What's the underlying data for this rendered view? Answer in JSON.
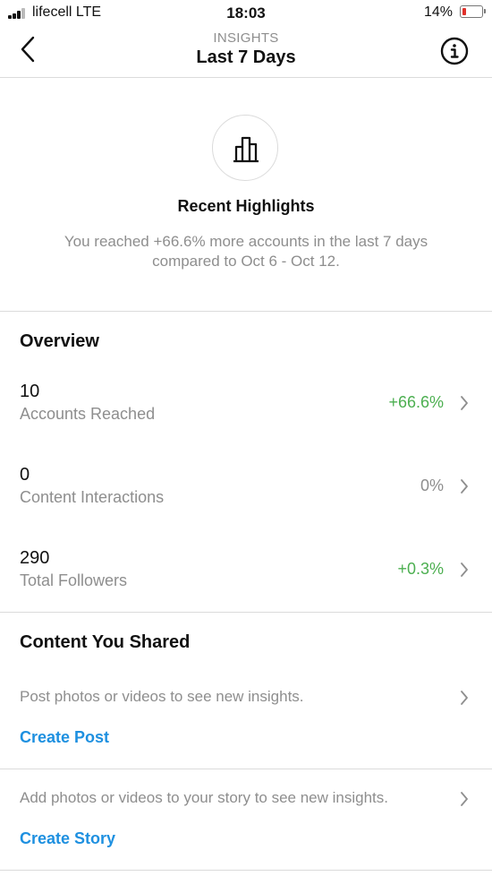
{
  "status_bar": {
    "carrier": "lifecell  LTE",
    "time": "18:03",
    "battery_percent": "14%",
    "battery_level": 0.14,
    "battery_color": "#e0302a"
  },
  "nav": {
    "subtitle": "INSIGHTS",
    "title": "Last 7 Days",
    "back_icon": "chevron-left-icon",
    "info_icon": "info-icon"
  },
  "highlights": {
    "icon": "bar-chart-icon",
    "title": "Recent Highlights",
    "description": "You reached +66.6% more accounts in the last 7 days compared to Oct 6 - Oct 12."
  },
  "overview": {
    "title": "Overview",
    "metrics": [
      {
        "value": "10",
        "label": "Accounts Reached",
        "change": "+66.6%",
        "change_color": "#4caf50"
      },
      {
        "value": "0",
        "label": "Content Interactions",
        "change": "0%",
        "change_color": "#8e8e8e"
      },
      {
        "value": "290",
        "label": "Total Followers",
        "change": "+0.3%",
        "change_color": "#4caf50"
      }
    ]
  },
  "content_shared": {
    "title": "Content You Shared",
    "post_text": "Post photos or videos to see new insights.",
    "post_link": "Create Post",
    "story_text": "Add photos or videos to your story to see new insights.",
    "story_link": "Create Story",
    "link_color": "#1e90e0"
  }
}
